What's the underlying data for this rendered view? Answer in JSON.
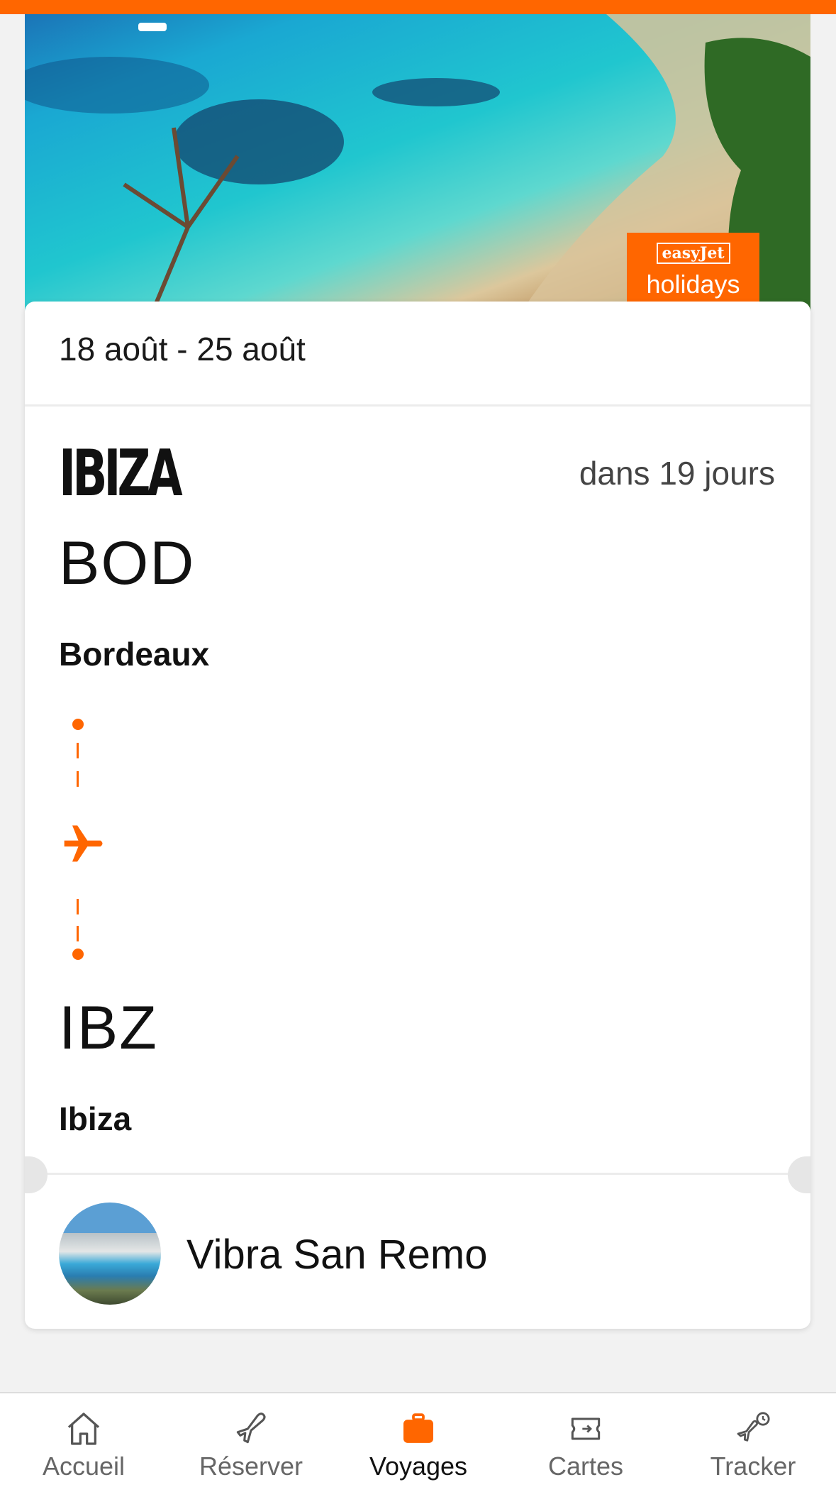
{
  "theme": {
    "accent": "#ff6600",
    "background": "#f2f2f2"
  },
  "hero": {
    "image": "beach-cove-photo",
    "badge": {
      "brand": "easyJet",
      "sub": "holidays"
    }
  },
  "booking": {
    "dates": "18 août - 25 août",
    "destination_title": "IBIZA",
    "countdown": "dans 19 jours",
    "origin": {
      "code": "BOD",
      "name": "Bordeaux"
    },
    "destination": {
      "code": "IBZ",
      "name": "Ibiza"
    },
    "route_icon": "plane-icon",
    "hotel": {
      "name": "Vibra San Remo",
      "thumbnail": "hotel-photo"
    }
  },
  "nav": {
    "items": [
      {
        "label": "Accueil",
        "icon": "home-icon",
        "active": false
      },
      {
        "label": "Réserver",
        "icon": "plane-icon",
        "active": false
      },
      {
        "label": "Voyages",
        "icon": "suitcase-icon",
        "active": true
      },
      {
        "label": "Cartes",
        "icon": "boarding-pass-icon",
        "active": false
      },
      {
        "label": "Tracker",
        "icon": "flight-tracker-icon",
        "active": false
      }
    ]
  }
}
